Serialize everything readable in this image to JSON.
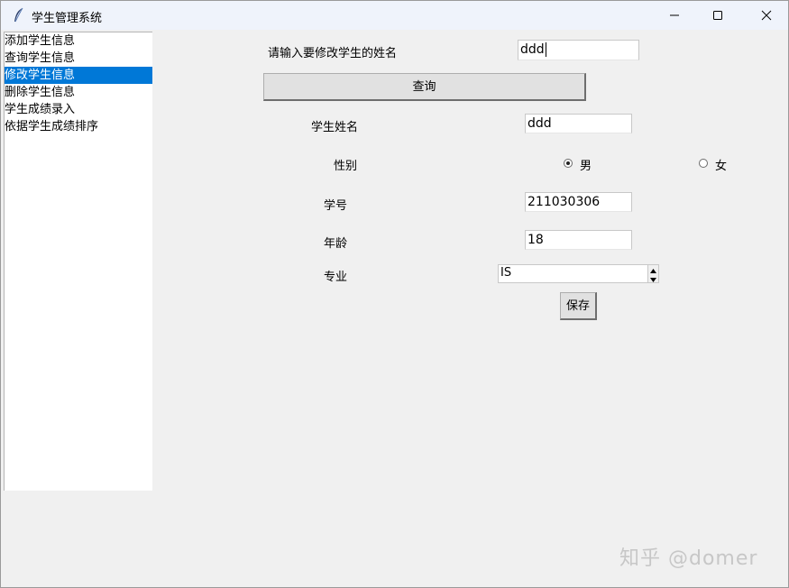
{
  "window": {
    "title": "学生管理系统"
  },
  "menu": {
    "items": [
      {
        "label": "添加学生信息",
        "selected": false
      },
      {
        "label": "查询学生信息",
        "selected": false
      },
      {
        "label": "修改学生信息",
        "selected": true
      },
      {
        "label": "删除学生信息",
        "selected": false
      },
      {
        "label": "学生成绩录入",
        "selected": false
      },
      {
        "label": "依据学生成绩排序",
        "selected": false
      }
    ]
  },
  "search": {
    "prompt_label": "请输入要修改学生的姓名",
    "input_value": "ddd",
    "query_button_label": "查询"
  },
  "form": {
    "name_label": "学生姓名",
    "name_value": "ddd",
    "gender_label": "性别",
    "gender_options": [
      "男",
      "女"
    ],
    "gender_selected": "男",
    "id_label": "学号",
    "id_value": "211030306",
    "age_label": "年龄",
    "age_value": "18",
    "major_label": "专业",
    "major_value": "IS",
    "save_button_label": "保存"
  },
  "watermark": "知乎 @domer",
  "colors": {
    "selection": "#0078d7",
    "background": "#f0f0f0",
    "titlebar": "#eff3fb"
  }
}
